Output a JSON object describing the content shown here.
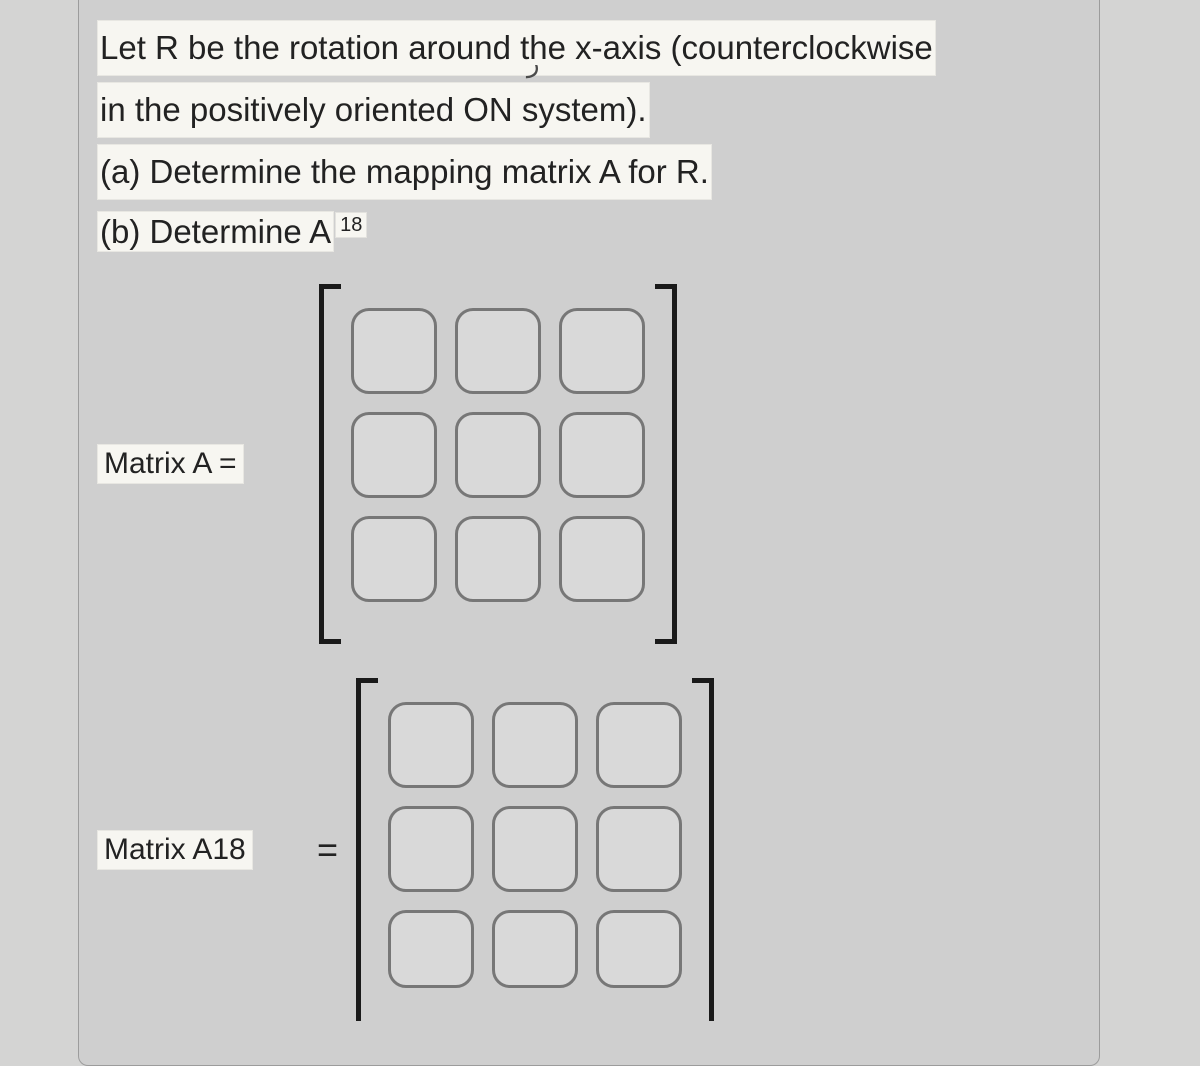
{
  "question": {
    "line1": "Let R be the rotation around the x-axis (counterclockwise",
    "line2": "in the positively oriented ON system).",
    "part_a": "(a) Determine the mapping matrix A for R.",
    "part_b_prefix": "(b) Determine A",
    "part_b_exponent": "18",
    "curl_glyph": "ﺭ"
  },
  "matrix_a": {
    "label": "Matrix A =",
    "rows": 3,
    "cols": 3,
    "values": [
      [
        "",
        "",
        ""
      ],
      [
        "",
        "",
        ""
      ],
      [
        "",
        "",
        ""
      ]
    ]
  },
  "matrix_a18": {
    "label": "Matrix A18",
    "equals": "=",
    "rows": 3,
    "cols": 3,
    "values": [
      [
        "",
        "",
        ""
      ],
      [
        "",
        "",
        ""
      ],
      [
        "",
        "",
        ""
      ]
    ]
  }
}
